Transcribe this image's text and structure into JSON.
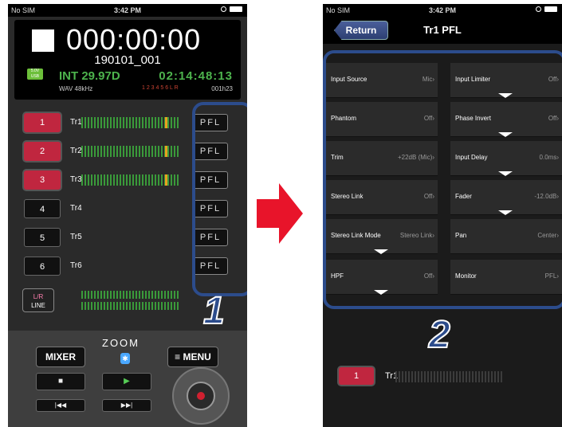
{
  "left_phone": {
    "status": {
      "carrier": "No SIM",
      "time": "3:42 PM"
    },
    "recorder": {
      "counter": "000:00:00",
      "filename": "190101_001",
      "usb_badge": "5.0V USB",
      "tc_mode": "INT 29.97D",
      "timecode": "02:14:48:13",
      "format": "WAV 48kHz",
      "armed_tracks": "1 2 3 4 5 6 L R",
      "take": "001h23"
    },
    "tracks": [
      {
        "num": "1",
        "label": "Tr1",
        "armed": true
      },
      {
        "num": "2",
        "label": "Tr2",
        "armed": true
      },
      {
        "num": "3",
        "label": "Tr3",
        "armed": true
      },
      {
        "num": "4",
        "label": "Tr4",
        "armed": false
      },
      {
        "num": "5",
        "label": "Tr5",
        "armed": false
      },
      {
        "num": "6",
        "label": "Tr6",
        "armed": false
      }
    ],
    "pfl_label": "PFL",
    "lr_button": {
      "top": "L/R",
      "bottom": "LINE"
    },
    "mixer_label": "MIXER",
    "menu_label": "≡ MENU",
    "logo": "ZOOM",
    "callout_number": "1"
  },
  "right_phone": {
    "status": {
      "carrier": "No SIM",
      "time": "3:42 PM"
    },
    "return_label": "Return",
    "title": "Tr1 PFL",
    "left_params": [
      {
        "label": "Input Source",
        "value": "Mic›"
      },
      {
        "label": "Phantom",
        "value": "Off›"
      },
      {
        "label": "Trim",
        "value": "+22dB (Mic)›"
      },
      {
        "label": "Stereo Link",
        "value": "Off›"
      },
      {
        "label": "Stereo Link Mode",
        "value": "Stereo Link›"
      },
      {
        "label": "HPF",
        "value": "Off›"
      }
    ],
    "right_params": [
      {
        "label": "Input Limiter",
        "value": "Off›"
      },
      {
        "label": "Phase Invert",
        "value": "Off›"
      },
      {
        "label": "Input Delay",
        "value": "0.0ms›"
      },
      {
        "label": "Fader",
        "value": "-12.0dB›"
      },
      {
        "label": "Pan",
        "value": "Center›"
      },
      {
        "label": "Monitor",
        "value": "PFL›"
      }
    ],
    "track": {
      "num": "1",
      "label": "Tr1"
    },
    "callout_number": "2"
  },
  "colors": {
    "accent_blue": "#2c4c8c",
    "track_armed": "#c0263f",
    "arrow_red": "#e8142a",
    "timecode_green": "#4db34d"
  }
}
